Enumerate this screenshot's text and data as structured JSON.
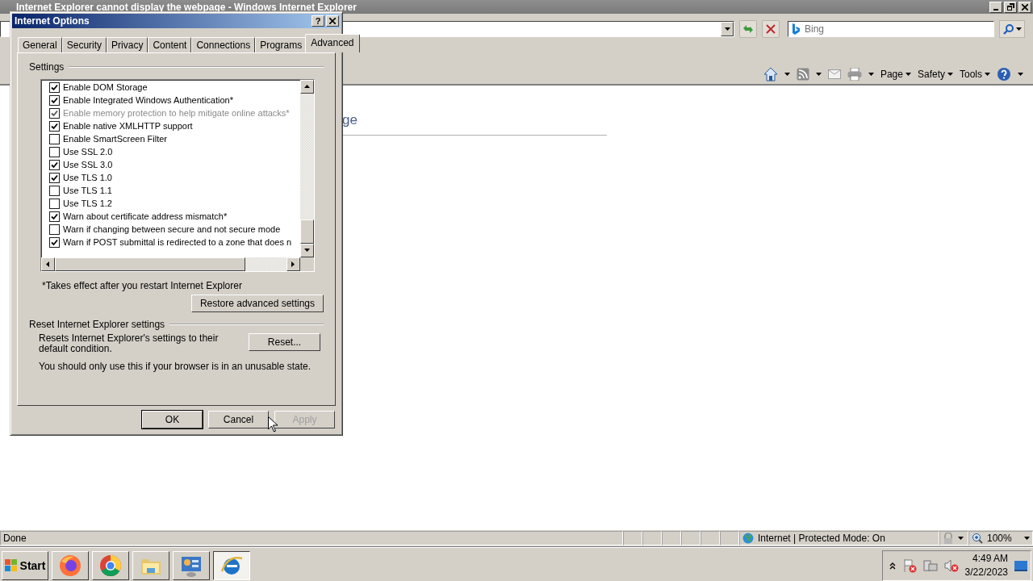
{
  "browser": {
    "title": "Internet Explorer cannot display the webpage - Windows Internet Explorer",
    "search": {
      "placeholder": "Bing"
    },
    "command_menus": [
      "Page",
      "Safety",
      "Tools"
    ]
  },
  "page": {
    "heading_fragment": "ge"
  },
  "dialog": {
    "title": "Internet Options",
    "help": "?",
    "tabs": [
      {
        "label": "General",
        "selected": false
      },
      {
        "label": "Security",
        "selected": false
      },
      {
        "label": "Privacy",
        "selected": false
      },
      {
        "label": "Content",
        "selected": false
      },
      {
        "label": "Connections",
        "selected": false
      },
      {
        "label": "Programs",
        "selected": false
      },
      {
        "label": "Advanced",
        "selected": true
      }
    ],
    "settings_label": "Settings",
    "settings": [
      {
        "label": "Enable DOM Storage",
        "checked": true,
        "disabled": false
      },
      {
        "label": "Enable Integrated Windows Authentication*",
        "checked": true,
        "disabled": false
      },
      {
        "label": "Enable memory protection to help mitigate online attacks*",
        "checked": true,
        "disabled": true
      },
      {
        "label": "Enable native XMLHTTP support",
        "checked": true,
        "disabled": false
      },
      {
        "label": "Enable SmartScreen Filter",
        "checked": false,
        "disabled": false
      },
      {
        "label": "Use SSL 2.0",
        "checked": false,
        "disabled": false
      },
      {
        "label": "Use SSL 3.0",
        "checked": true,
        "disabled": false
      },
      {
        "label": "Use TLS 1.0",
        "checked": true,
        "disabled": false
      },
      {
        "label": "Use TLS 1.1",
        "checked": false,
        "disabled": false
      },
      {
        "label": "Use TLS 1.2",
        "checked": false,
        "disabled": false
      },
      {
        "label": "Warn about certificate address mismatch*",
        "checked": true,
        "disabled": false
      },
      {
        "label": "Warn if changing between secure and not secure mode",
        "checked": false,
        "disabled": false
      },
      {
        "label": "Warn if POST submittal is redirected to a zone that does n",
        "checked": true,
        "disabled": false
      }
    ],
    "footnote": "*Takes effect after you restart Internet Explorer",
    "restore_button": "Restore advanced settings",
    "reset_group": "Reset Internet Explorer settings",
    "reset_description": "Resets Internet Explorer's settings to their default condition.",
    "reset_button": "Reset...",
    "reset_warning": "You should only use this if your browser is in an unusable state.",
    "buttons": [
      {
        "label": "OK",
        "disabled": false,
        "default": true
      },
      {
        "label": "Cancel",
        "disabled": false,
        "default": false
      },
      {
        "label": "Apply",
        "disabled": true,
        "default": false
      }
    ]
  },
  "status_bar": {
    "text": "Done",
    "zone": "Internet | Protected Mode: On",
    "zoom": "100%"
  },
  "taskbar": {
    "start": "Start",
    "apps": [
      {
        "kind": "firefox",
        "selected": false
      },
      {
        "kind": "chrome",
        "selected": false
      },
      {
        "kind": "folder",
        "selected": false
      },
      {
        "kind": "control-panel",
        "selected": false
      },
      {
        "kind": "ie",
        "selected": true
      }
    ],
    "time": "4:49 AM",
    "date": "3/22/2023"
  }
}
